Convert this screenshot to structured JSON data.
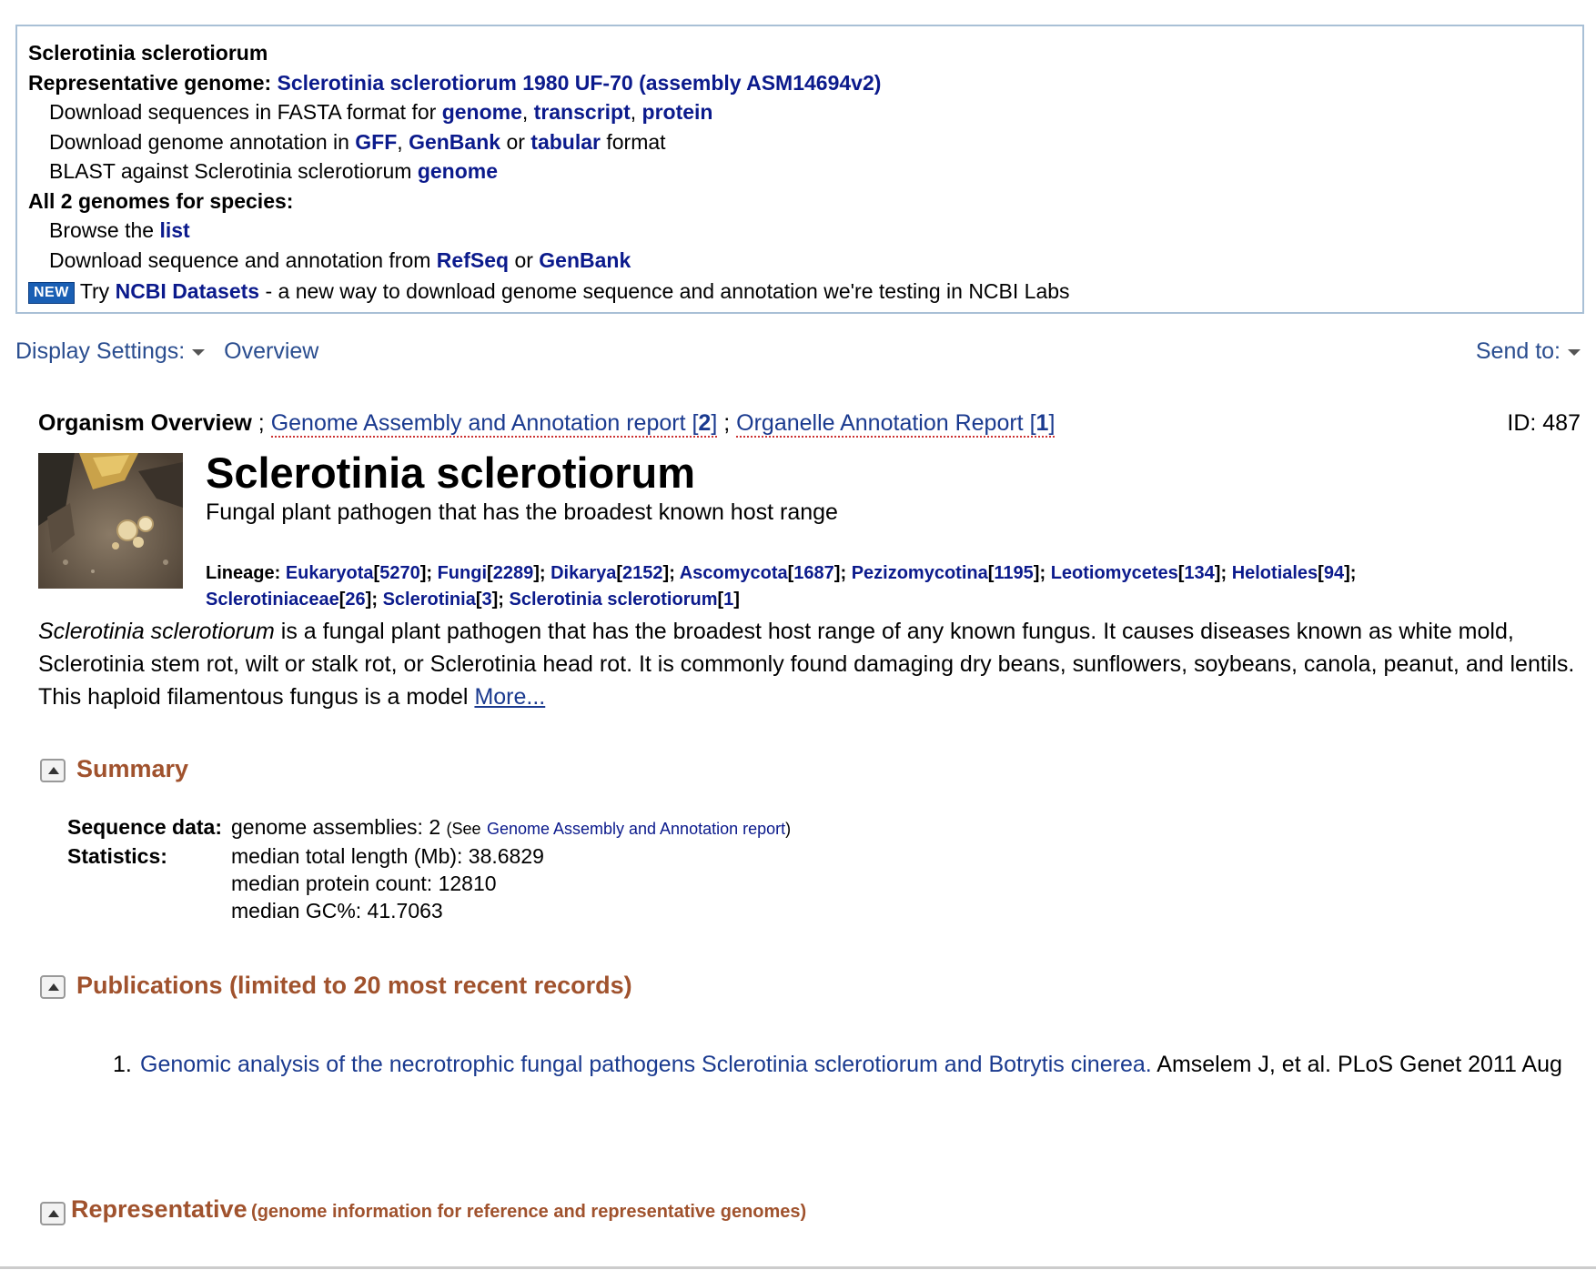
{
  "top_box": {
    "species": "Sclerotinia sclerotiorum",
    "rep_label": "Representative genome:",
    "rep_link": "Sclerotinia sclerotiorum 1980 UF-70 (assembly ASM14694v2)",
    "fasta_text": "Download sequences in FASTA format for",
    "fasta_links": [
      "genome",
      "transcript",
      "protein"
    ],
    "annot_text": "Download genome annotation in",
    "annot_links": [
      "GFF",
      "GenBank",
      "tabular"
    ],
    "annot_or": "or",
    "annot_suffix": "format",
    "blast_text": "BLAST against Sclerotinia sclerotiorum",
    "blast_link": "genome",
    "all_label": "All 2 genomes for species:",
    "browse_text": "Browse the",
    "browse_link": "list",
    "dl_text": "Download sequence and annotation from",
    "dl_links": [
      "RefSeq",
      "GenBank"
    ],
    "dl_or": "or",
    "new_badge": "NEW",
    "try_text": "Try",
    "datasets_link": "NCBI Datasets",
    "datasets_suffix": "- a new way to download genome sequence and annotation we're testing in NCBI Labs"
  },
  "toolbar": {
    "display_settings": "Display Settings:",
    "overview": "Overview",
    "send_to": "Send to:"
  },
  "overview": {
    "label": "Organism Overview",
    "sep": ";",
    "report1_text": "Genome Assembly and Annotation report [",
    "report1_count": "2",
    "report2_text": "Organelle Annotation Report [",
    "report2_count": "1",
    "id": "ID: 487"
  },
  "organism": {
    "title": "Sclerotinia sclerotiorum",
    "subtitle": "Fungal plant pathogen that has the broadest known host range",
    "lineage_label": "Lineage:",
    "lineage": [
      {
        "name": "Eukaryota",
        "count": "5270"
      },
      {
        "name": "Fungi",
        "count": "2289"
      },
      {
        "name": "Dikarya",
        "count": "2152"
      },
      {
        "name": "Ascomycota",
        "count": "1687"
      },
      {
        "name": "Pezizomycotina",
        "count": "1195"
      },
      {
        "name": "Leotiomycetes",
        "count": "134"
      },
      {
        "name": "Helotiales",
        "count": "94"
      },
      {
        "name": "Sclerotiniaceae",
        "count": "26"
      },
      {
        "name": "Sclerotinia",
        "count": "3"
      },
      {
        "name": "Sclerotinia sclerotiorum",
        "count": "1"
      }
    ],
    "desc_italic": "Sclerotinia sclerotiorum",
    "desc_text": " is a fungal plant pathogen that has the broadest host range of any known fungus. It causes diseases known as white mold, Sclerotinia stem rot, wilt or stalk rot, or Sclerotinia head rot. It is commonly found damaging dry beans, sunflowers, soybeans, canola, peanut, and lentils. This haploid filamentous fungus is a model ",
    "more": "More..."
  },
  "summary": {
    "heading": "Summary",
    "seq_label": "Sequence data:",
    "seq_value": "genome assemblies: 2",
    "see_open": "(See",
    "see_link": "Genome Assembly and Annotation report",
    "see_close": ")",
    "stats_label": "Statistics:",
    "stats": [
      "median total length (Mb): 38.6829",
      "median protein count: 12810",
      "median GC%: 41.7063"
    ]
  },
  "publications": {
    "heading": "Publications (limited to 20 most recent records)",
    "items": [
      {
        "num": "1.",
        "title": "Genomic analysis of the necrotrophic fungal pathogens Sclerotinia sclerotiorum and Botrytis cinerea.",
        "cite": " Amselem J, et al. PLoS Genet 2011 Aug"
      }
    ]
  },
  "representative": {
    "heading": "Representative",
    "sub": "(genome information for reference and representative genomes)"
  }
}
